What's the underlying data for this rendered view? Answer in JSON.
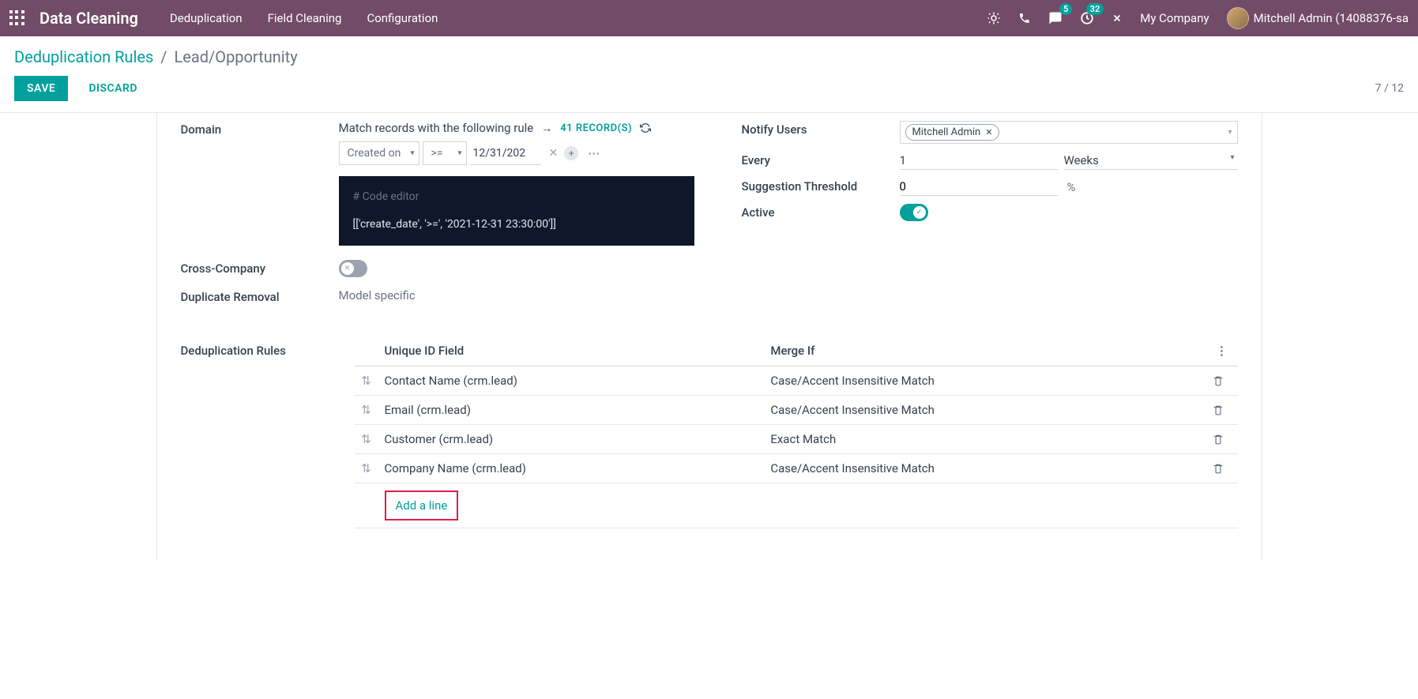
{
  "topnav": {
    "brand": "Data Cleaning",
    "links": [
      "Deduplication",
      "Field Cleaning",
      "Configuration"
    ],
    "msg_badge": "5",
    "activity_badge": "32",
    "company": "My Company",
    "user": "Mitchell Admin (14088376-sa"
  },
  "breadcrumb": {
    "parent": "Deduplication Rules",
    "current": "Lead/Opportunity"
  },
  "actions": {
    "save": "SAVE",
    "discard": "DISCARD",
    "pager": "7 / 12"
  },
  "form": {
    "domain_label": "Domain",
    "domain_intro": "Match records with the following rule",
    "records": "41 RECORD(S)",
    "filter_field": "Created on",
    "filter_op": ">=",
    "filter_val": "12/31/202",
    "code_comment": "# Code editor",
    "code_body": "[['create_date', '>=', '2021-12-31 23:30:00']]",
    "cross_company_label": "Cross-Company",
    "dup_removal_label": "Duplicate Removal",
    "dup_removal_value": "Model specific",
    "notify_label": "Notify Users",
    "notify_tag": "Mitchell Admin",
    "every_label": "Every",
    "every_value": "1",
    "every_unit": "Weeks",
    "threshold_label": "Suggestion Threshold",
    "threshold_value": "0",
    "threshold_unit": "%",
    "active_label": "Active"
  },
  "rules": {
    "section_label": "Deduplication Rules",
    "col1": "Unique ID Field",
    "col2": "Merge If",
    "rows": [
      {
        "field": "Contact Name (crm.lead)",
        "merge": "Case/Accent Insensitive Match"
      },
      {
        "field": "Email (crm.lead)",
        "merge": "Case/Accent Insensitive Match"
      },
      {
        "field": "Customer (crm.lead)",
        "merge": "Exact Match"
      },
      {
        "field": "Company Name (crm.lead)",
        "merge": "Case/Accent Insensitive Match"
      }
    ],
    "add": "Add a line"
  }
}
